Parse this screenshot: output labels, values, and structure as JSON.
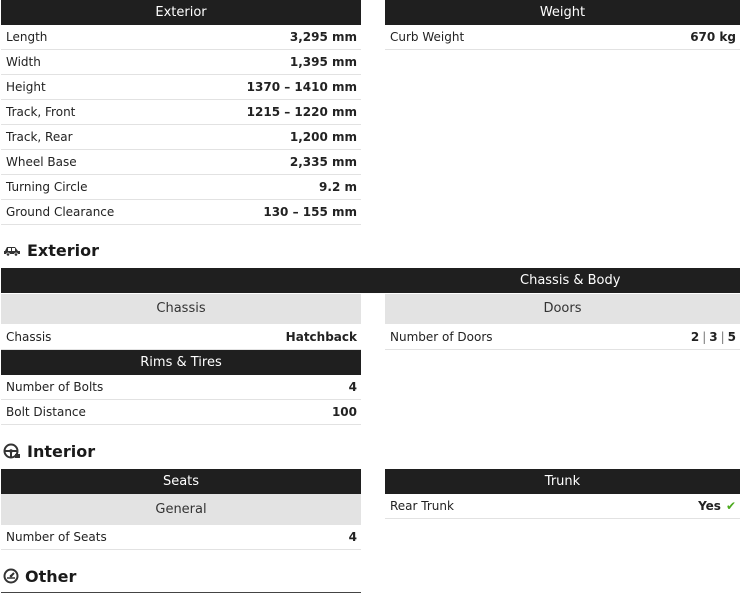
{
  "exterior_dims": {
    "header": "Exterior",
    "rows": [
      {
        "label": "Length",
        "value": "3,295 mm"
      },
      {
        "label": "Width",
        "value": "1,395 mm"
      },
      {
        "label": "Height",
        "value": "1370 – 1410 mm"
      },
      {
        "label": "Track, Front",
        "value": "1215 – 1220 mm"
      },
      {
        "label": "Track, Rear",
        "value": "1,200 mm"
      },
      {
        "label": "Wheel Base",
        "value": "2,335 mm"
      },
      {
        "label": "Turning Circle",
        "value": "9.2 m"
      },
      {
        "label": "Ground Clearance",
        "value": "130 – 155 mm"
      }
    ]
  },
  "weight": {
    "header": "Weight",
    "rows": [
      {
        "label": "Curb Weight",
        "value": "670 kg"
      }
    ]
  },
  "sections": {
    "exterior": "Exterior",
    "interior": "Interior",
    "other": "Other"
  },
  "icons": {
    "exterior": "car-icon",
    "interior": "steering-wheel-icon",
    "other": "speedometer-icon"
  },
  "chassis_body": {
    "header": "Chassis & Body",
    "chassis": {
      "header": "Chassis",
      "rows": [
        {
          "label": "Chassis",
          "value": "Hatchback"
        }
      ]
    },
    "doors": {
      "header": "Doors",
      "label": "Number of Doors",
      "options": [
        "2",
        "3",
        "5"
      ]
    },
    "rims": {
      "header": "Rims & Tires",
      "rows": [
        {
          "label": "Number of Bolts",
          "value": "4"
        },
        {
          "label": "Bolt Distance",
          "value": "100"
        }
      ]
    }
  },
  "interior": {
    "seats": {
      "header": "Seats",
      "sub": "General",
      "rows": [
        {
          "label": "Number of Seats",
          "value": "4"
        }
      ]
    },
    "trunk": {
      "header": "Trunk",
      "rows": [
        {
          "label": "Rear Trunk",
          "value": "Yes"
        }
      ]
    }
  },
  "colors": {
    "header_bg": "#1f1f1f",
    "subheader_bg": "#e3e3e3",
    "check": "#4caa1e"
  }
}
